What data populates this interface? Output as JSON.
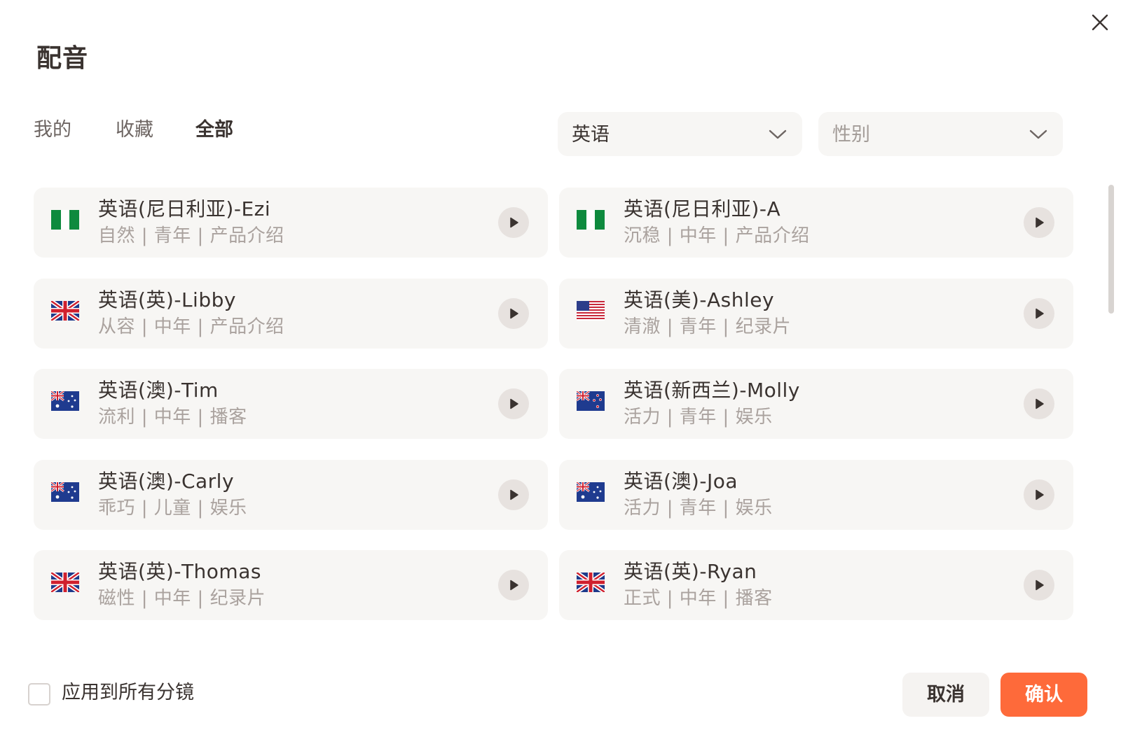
{
  "dialog": {
    "title": "配音"
  },
  "tabs": [
    {
      "label": "我的",
      "active": false
    },
    {
      "label": "收藏",
      "active": false
    },
    {
      "label": "全部",
      "active": true
    }
  ],
  "filters": {
    "language": {
      "value": "英语"
    },
    "gender": {
      "placeholder": "性别"
    }
  },
  "voices": [
    {
      "name": "英语(尼日利亚)-Ezi",
      "tags": "自然 | 青年 | 产品介绍",
      "flag": "nigeria-flag-icon"
    },
    {
      "name": "英语(尼日利亚)-A",
      "tags": "沉稳 | 中年 | 产品介绍",
      "flag": "nigeria-flag-icon"
    },
    {
      "name": "英语(英)-Libby",
      "tags": "从容 | 中年 | 产品介绍",
      "flag": "uk-flag-icon"
    },
    {
      "name": "英语(美)-Ashley",
      "tags": "清澈 | 青年 | 纪录片",
      "flag": "us-flag-icon"
    },
    {
      "name": "英语(澳)-Tim",
      "tags": "流利 | 中年 | 播客",
      "flag": "australia-flag-icon"
    },
    {
      "name": "英语(新西兰)-Molly",
      "tags": "活力 | 青年 | 娱乐",
      "flag": "new-zealand-flag-icon"
    },
    {
      "name": "英语(澳)-Carly",
      "tags": "乖巧 | 儿童 | 娱乐",
      "flag": "australia-flag-icon"
    },
    {
      "name": "英语(澳)-Joa",
      "tags": "活力 | 青年 | 娱乐",
      "flag": "australia-flag-icon"
    },
    {
      "name": "英语(英)-Thomas",
      "tags": "磁性 | 中年 | 纪录片",
      "flag": "uk-flag-icon"
    },
    {
      "name": "英语(英)-Ryan",
      "tags": "正式 | 中年 | 播客",
      "flag": "uk-flag-icon"
    }
  ],
  "footer": {
    "apply_all_label": "应用到所有分镜",
    "apply_all_checked": false,
    "cancel_label": "取消",
    "confirm_label": "确认"
  },
  "colors": {
    "accent": "#fe6a3a",
    "card_bg": "#f7f6f4",
    "text_primary": "#3a3330",
    "text_secondary": "#aaa29e"
  }
}
